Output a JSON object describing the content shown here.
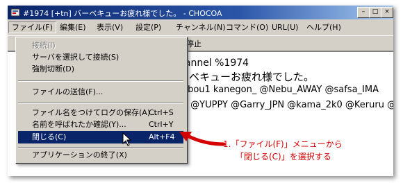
{
  "window": {
    "title": "#1974 [+tn] バーベキューお疲れ様でした。 - CHOCOA",
    "app_icon": "chocoa-app-icon"
  },
  "menubar": {
    "items": [
      {
        "label": "ファイル(F)"
      },
      {
        "label": "編集(E)"
      },
      {
        "label": "表示(V)"
      },
      {
        "label": "設定(P)"
      },
      {
        "label": "チャンネル(N)"
      },
      {
        "label": "コマンド(O)"
      },
      {
        "label": "URL(U)"
      },
      {
        "label": "ヘルプ(H)"
      }
    ]
  },
  "toolbar": {
    "label": "画面停止"
  },
  "content": {
    "lines": [
      "hannel %1974",
      "ーベキューお疲れ様でした。",
      "tabou1 kanegon_ @Nebu_AWAY @safsa_IMA",
      "Y] @YUPPY @Garry_JPN @kama_2k0 @Keruru @"
    ]
  },
  "file_menu": {
    "items": [
      {
        "label": "接続(I)",
        "shortcut": "",
        "disabled": true
      },
      {
        "label": "サーバを選択して接続(S)",
        "shortcut": "",
        "disabled": false
      },
      {
        "label": "強制切断(D)",
        "shortcut": "",
        "disabled": false
      },
      {
        "label": "ファイルの送信(F)...",
        "shortcut": "",
        "disabled": false
      },
      {
        "label": "ファイル名をつけてログの保存(A)...",
        "shortcut": "Ctrl+S",
        "disabled": false
      },
      {
        "label": "名前を呼ばれたか確認(Y)...",
        "shortcut": "Ctrl+Y",
        "disabled": false
      },
      {
        "label": "閉じる(C)",
        "shortcut": "Alt+F4",
        "disabled": false,
        "selected": true
      },
      {
        "label": "アプリケーションの終了(X)",
        "shortcut": "",
        "disabled": false
      }
    ]
  },
  "annotation": {
    "line1": "1.「ファイル(F)」メニューから",
    "line2": "「閉じる(C)」を選択する",
    "color": "#d40000"
  },
  "colors": {
    "titlebar": "#0a246a",
    "selection": "#0a246a",
    "face": "#d4d0c8"
  }
}
